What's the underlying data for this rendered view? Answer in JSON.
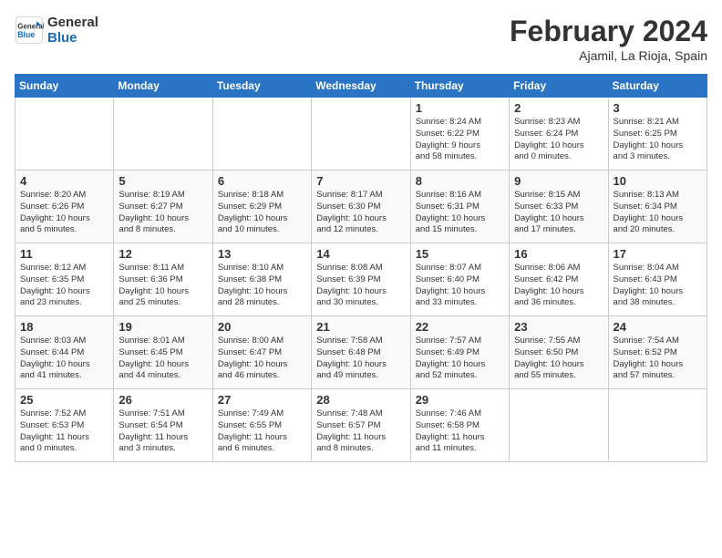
{
  "header": {
    "logo_line1": "General",
    "logo_line2": "Blue",
    "month": "February 2024",
    "location": "Ajamil, La Rioja, Spain"
  },
  "weekdays": [
    "Sunday",
    "Monday",
    "Tuesday",
    "Wednesday",
    "Thursday",
    "Friday",
    "Saturday"
  ],
  "weeks": [
    [
      {
        "day": "",
        "info": ""
      },
      {
        "day": "",
        "info": ""
      },
      {
        "day": "",
        "info": ""
      },
      {
        "day": "",
        "info": ""
      },
      {
        "day": "1",
        "info": "Sunrise: 8:24 AM\nSunset: 6:22 PM\nDaylight: 9 hours\nand 58 minutes."
      },
      {
        "day": "2",
        "info": "Sunrise: 8:23 AM\nSunset: 6:24 PM\nDaylight: 10 hours\nand 0 minutes."
      },
      {
        "day": "3",
        "info": "Sunrise: 8:21 AM\nSunset: 6:25 PM\nDaylight: 10 hours\nand 3 minutes."
      }
    ],
    [
      {
        "day": "4",
        "info": "Sunrise: 8:20 AM\nSunset: 6:26 PM\nDaylight: 10 hours\nand 5 minutes."
      },
      {
        "day": "5",
        "info": "Sunrise: 8:19 AM\nSunset: 6:27 PM\nDaylight: 10 hours\nand 8 minutes."
      },
      {
        "day": "6",
        "info": "Sunrise: 8:18 AM\nSunset: 6:29 PM\nDaylight: 10 hours\nand 10 minutes."
      },
      {
        "day": "7",
        "info": "Sunrise: 8:17 AM\nSunset: 6:30 PM\nDaylight: 10 hours\nand 12 minutes."
      },
      {
        "day": "8",
        "info": "Sunrise: 8:16 AM\nSunset: 6:31 PM\nDaylight: 10 hours\nand 15 minutes."
      },
      {
        "day": "9",
        "info": "Sunrise: 8:15 AM\nSunset: 6:33 PM\nDaylight: 10 hours\nand 17 minutes."
      },
      {
        "day": "10",
        "info": "Sunrise: 8:13 AM\nSunset: 6:34 PM\nDaylight: 10 hours\nand 20 minutes."
      }
    ],
    [
      {
        "day": "11",
        "info": "Sunrise: 8:12 AM\nSunset: 6:35 PM\nDaylight: 10 hours\nand 23 minutes."
      },
      {
        "day": "12",
        "info": "Sunrise: 8:11 AM\nSunset: 6:36 PM\nDaylight: 10 hours\nand 25 minutes."
      },
      {
        "day": "13",
        "info": "Sunrise: 8:10 AM\nSunset: 6:38 PM\nDaylight: 10 hours\nand 28 minutes."
      },
      {
        "day": "14",
        "info": "Sunrise: 8:08 AM\nSunset: 6:39 PM\nDaylight: 10 hours\nand 30 minutes."
      },
      {
        "day": "15",
        "info": "Sunrise: 8:07 AM\nSunset: 6:40 PM\nDaylight: 10 hours\nand 33 minutes."
      },
      {
        "day": "16",
        "info": "Sunrise: 8:06 AM\nSunset: 6:42 PM\nDaylight: 10 hours\nand 36 minutes."
      },
      {
        "day": "17",
        "info": "Sunrise: 8:04 AM\nSunset: 6:43 PM\nDaylight: 10 hours\nand 38 minutes."
      }
    ],
    [
      {
        "day": "18",
        "info": "Sunrise: 8:03 AM\nSunset: 6:44 PM\nDaylight: 10 hours\nand 41 minutes."
      },
      {
        "day": "19",
        "info": "Sunrise: 8:01 AM\nSunset: 6:45 PM\nDaylight: 10 hours\nand 44 minutes."
      },
      {
        "day": "20",
        "info": "Sunrise: 8:00 AM\nSunset: 6:47 PM\nDaylight: 10 hours\nand 46 minutes."
      },
      {
        "day": "21",
        "info": "Sunrise: 7:58 AM\nSunset: 6:48 PM\nDaylight: 10 hours\nand 49 minutes."
      },
      {
        "day": "22",
        "info": "Sunrise: 7:57 AM\nSunset: 6:49 PM\nDaylight: 10 hours\nand 52 minutes."
      },
      {
        "day": "23",
        "info": "Sunrise: 7:55 AM\nSunset: 6:50 PM\nDaylight: 10 hours\nand 55 minutes."
      },
      {
        "day": "24",
        "info": "Sunrise: 7:54 AM\nSunset: 6:52 PM\nDaylight: 10 hours\nand 57 minutes."
      }
    ],
    [
      {
        "day": "25",
        "info": "Sunrise: 7:52 AM\nSunset: 6:53 PM\nDaylight: 11 hours\nand 0 minutes."
      },
      {
        "day": "26",
        "info": "Sunrise: 7:51 AM\nSunset: 6:54 PM\nDaylight: 11 hours\nand 3 minutes."
      },
      {
        "day": "27",
        "info": "Sunrise: 7:49 AM\nSunset: 6:55 PM\nDaylight: 11 hours\nand 6 minutes."
      },
      {
        "day": "28",
        "info": "Sunrise: 7:48 AM\nSunset: 6:57 PM\nDaylight: 11 hours\nand 8 minutes."
      },
      {
        "day": "29",
        "info": "Sunrise: 7:46 AM\nSunset: 6:58 PM\nDaylight: 11 hours\nand 11 minutes."
      },
      {
        "day": "",
        "info": ""
      },
      {
        "day": "",
        "info": ""
      }
    ]
  ]
}
